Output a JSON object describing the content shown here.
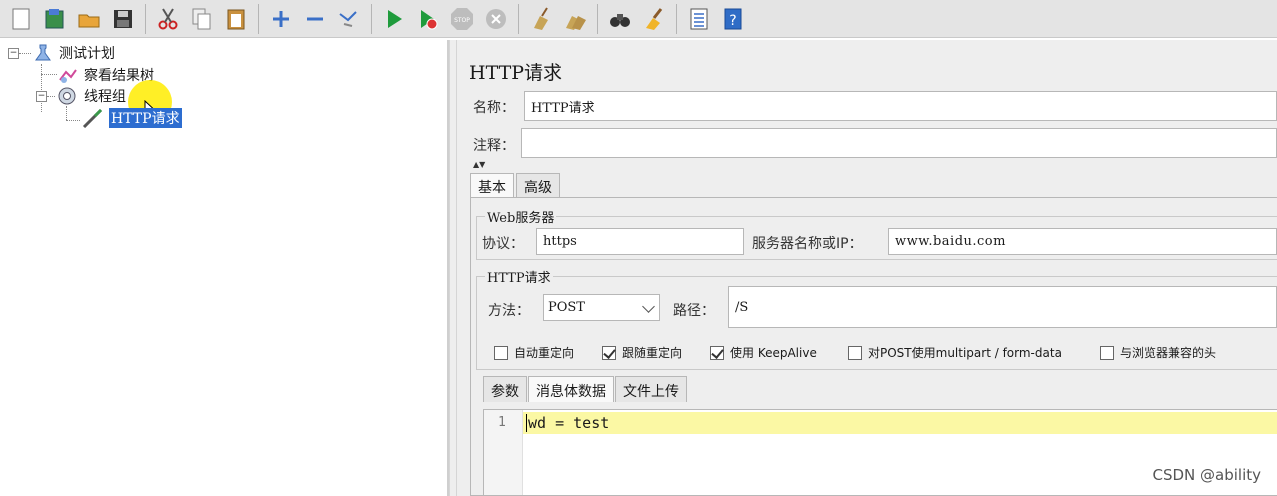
{
  "toolbar": {
    "icons": [
      "new-icon",
      "templates-icon",
      "open-icon",
      "save-icon",
      "cut-icon",
      "copy-icon",
      "paste-icon",
      "expand-icon",
      "collapse-icon",
      "toggle-icon",
      "start-icon",
      "start-no-pause-icon",
      "stop-icon",
      "shutdown-icon",
      "clear-icon",
      "clear-all-icon",
      "search-icon",
      "reset-search-icon",
      "function-helper-icon",
      "help-icon"
    ],
    "stop_label": "STOP"
  },
  "tree": {
    "root": "测试计划",
    "listener": "察看结果树",
    "thread_group": "线程组",
    "sampler": "HTTP请求"
  },
  "panel": {
    "title": "HTTP请求",
    "name_label": "名称：",
    "name_value": "HTTP请求",
    "comment_label": "注释：",
    "comment_value": ""
  },
  "tabs": [
    "基本",
    "高级"
  ],
  "web_server": {
    "legend": "Web服务器",
    "protocol_label": "协议：",
    "protocol_value": "https",
    "server_label": "服务器名称或IP：",
    "server_value": "www.baidu.com"
  },
  "http_request": {
    "legend": "HTTP请求",
    "method_label": "方法：",
    "method_value": "POST",
    "path_label": "路径：",
    "path_value": "/S"
  },
  "options": [
    {
      "label": "自动重定向",
      "checked": false
    },
    {
      "label": "跟随重定向",
      "checked": true
    },
    {
      "label": "使用 KeepAlive",
      "checked": true
    },
    {
      "label": "对POST使用multipart / form-data",
      "checked": false
    },
    {
      "label": "与浏览器兼容的头",
      "checked": false
    }
  ],
  "body_tabs": [
    "参数",
    "消息体数据",
    "文件上传"
  ],
  "editor": {
    "line_number": "1",
    "code": "wd = test"
  },
  "watermark": "CSDN @ability",
  "colors": {
    "selection": "#2d6dd0",
    "line_highlight": "#fbf8a4",
    "cursor_spot": "#ffec00"
  }
}
